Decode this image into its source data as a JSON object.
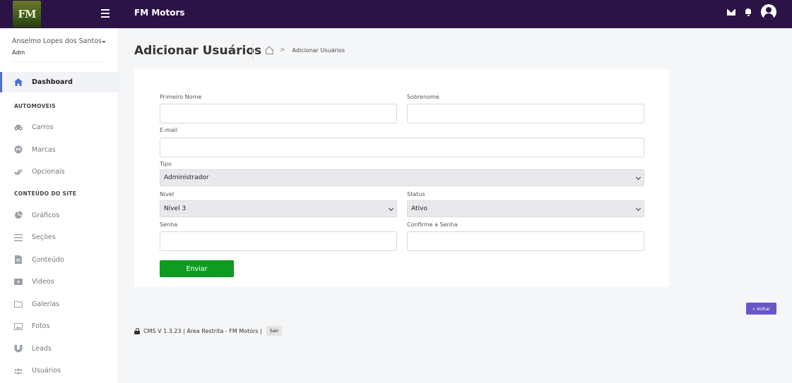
{
  "header": {
    "logo_text": "FM",
    "app_title": "FM Motors",
    "icons": [
      "envelope-icon",
      "bell-icon",
      "user-circle-icon"
    ]
  },
  "profile": {
    "name": "Anselmo Lopes dos Santos",
    "role": "Adm"
  },
  "sidebar": {
    "dashboard": {
      "label": "Dashboard",
      "icon": "home-icon"
    },
    "section_automoveis": "AUTOMOVEIS",
    "automoveis": [
      {
        "label": "Carros",
        "icon": "car-icon"
      },
      {
        "label": "Marcas",
        "icon": "brand-badge-icon"
      },
      {
        "label": "Opcionais",
        "icon": "check-double-icon"
      }
    ],
    "section_conteudo": "CONTEÚDO DO SITE",
    "conteudo": [
      {
        "label": "Gráficos",
        "icon": "pie-chart-icon"
      },
      {
        "label": "Seções",
        "icon": "list-icon"
      },
      {
        "label": "Conteúdo",
        "icon": "file-icon"
      },
      {
        "label": "Videos",
        "icon": "video-icon"
      },
      {
        "label": "Galerias",
        "icon": "folder-icon"
      },
      {
        "label": "Fotos",
        "icon": "image-icon"
      },
      {
        "label": "Leads",
        "icon": "magnet-icon"
      },
      {
        "label": "Usuários",
        "icon": "users-icon"
      }
    ]
  },
  "page": {
    "title": "Adicionar Usuários",
    "breadcrumb": "Adicionar Usuários"
  },
  "form": {
    "first_name_label": "Primeiro Nome",
    "first_name_value": "",
    "last_name_label": "Sobrenome",
    "last_name_value": "",
    "email_label": "E-mail",
    "email_value": "",
    "type_label": "Tipo",
    "type_value": "Administrador",
    "level_label": "Nivel",
    "level_value": "Nivel 3",
    "status_label": "Status",
    "status_value": "Ativo",
    "password_label": "Senha",
    "confirm_label": "Confirme a Senha",
    "submit_label": "Enviar"
  },
  "back_label": "« Voltar",
  "footer": {
    "text": "CMS V 1.3.23 | Área Restrita - FM Motors |",
    "logout_label": "Sair"
  },
  "colors": {
    "topbar": "#2b1346",
    "accent": "#4a6fd8",
    "submit": "#109a22",
    "back_button": "#6a56c9"
  }
}
